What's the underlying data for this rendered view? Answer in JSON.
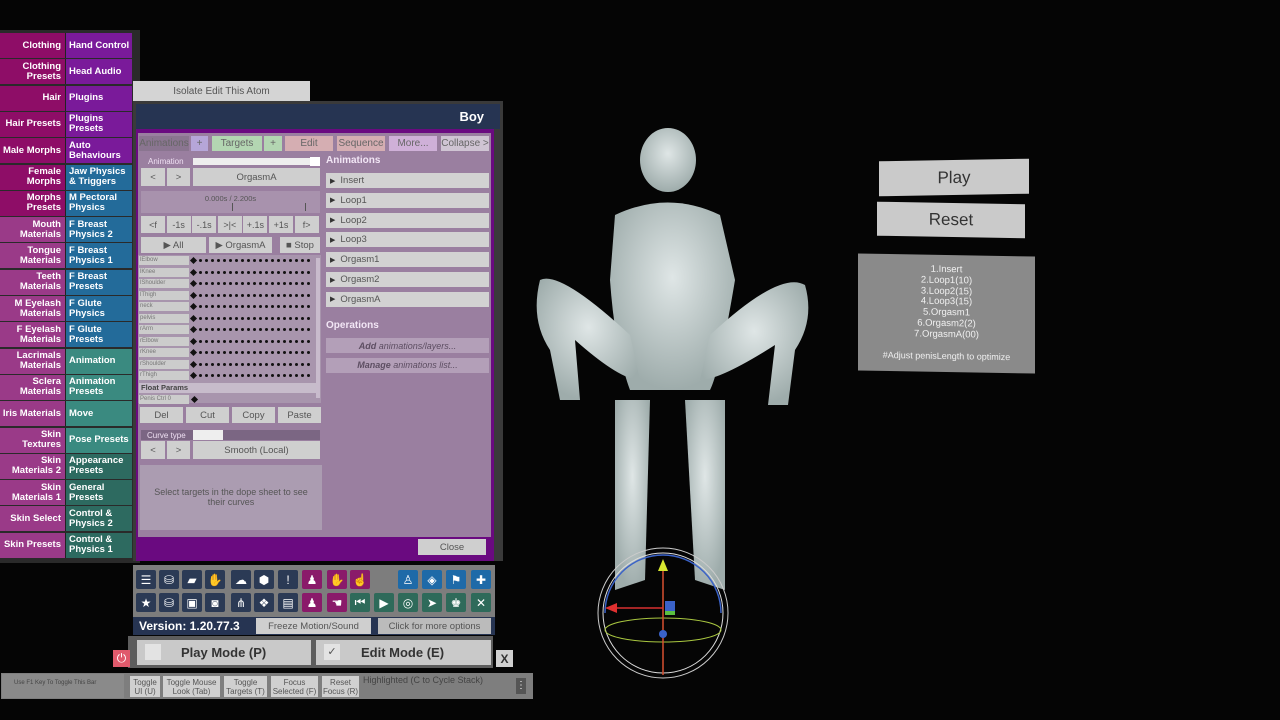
{
  "sidebar": {
    "rows": [
      {
        "left": "Clothing",
        "right": "Hand Control",
        "lc": "#8e0d67",
        "rc": "#7a1a9a"
      },
      {
        "left": "Clothing Presets",
        "right": "Head Audio",
        "lc": "#8e0d67",
        "rc": "#7a1a9a"
      },
      {
        "left": "Hair",
        "right": "Plugins",
        "lc": "#8e0d67",
        "rc": "#7a1a9a"
      },
      {
        "left": "Hair Presets",
        "right": "Plugins Presets",
        "lc": "#8e0d67",
        "rc": "#7a1a9a"
      },
      {
        "left": "Male Morphs",
        "right": "Auto Behaviours",
        "lc": "#8e0d67",
        "rc": "#7a1a9a"
      },
      {
        "left": "Female Morphs",
        "right": "Jaw Physics & Triggers",
        "lc": "#8e0d67",
        "rc": "#236b9a"
      },
      {
        "left": "Morphs Presets",
        "right": "M Pectoral Physics",
        "lc": "#8e0d67",
        "rc": "#236b9a"
      },
      {
        "left": "Mouth Materials",
        "right": "F Breast Physics 2",
        "lc": "#9a3a88",
        "rc": "#236b9a"
      },
      {
        "left": "Tongue Materials",
        "right": "F Breast Physics 1",
        "lc": "#9a3a88",
        "rc": "#236b9a"
      },
      {
        "left": "Teeth Materials",
        "right": "F Breast Presets",
        "lc": "#9a3a88",
        "rc": "#236b9a"
      },
      {
        "left": "M Eyelash Materials",
        "right": "F Glute Physics",
        "lc": "#9a3a88",
        "rc": "#236b9a"
      },
      {
        "left": "F Eyelash Materials",
        "right": "F Glute Presets",
        "lc": "#9a3a88",
        "rc": "#236b9a"
      },
      {
        "left": "Lacrimals Materials",
        "right": "Animation",
        "lc": "#9a3a88",
        "rc": "#3a8a80"
      },
      {
        "left": "Sclera Materials",
        "right": "Animation Presets",
        "lc": "#9a3a88",
        "rc": "#3a8a80"
      },
      {
        "left": "Iris Materials",
        "right": "Move",
        "lc": "#9a3a88",
        "rc": "#3a8a80"
      },
      {
        "left": "Skin Textures",
        "right": "Pose Presets",
        "lc": "#9a3a88",
        "rc": "#3a8a80"
      },
      {
        "left": "Skin Materials 2",
        "right": "Appearance Presets",
        "lc": "#9a3a88",
        "rc": "#2d6a60"
      },
      {
        "left": "Skin Materials 1",
        "right": "General Presets",
        "lc": "#9a3a88",
        "rc": "#2d6a60"
      },
      {
        "left": "Skin Select",
        "right": "Control & Physics 2",
        "lc": "#9a3a88",
        "rc": "#2d6a60"
      },
      {
        "left": "Skin Presets",
        "right": "Control & Physics 1",
        "lc": "#9a3a88",
        "rc": "#2d6a60"
      }
    ]
  },
  "isolate_button": "Isolate Edit This Atom",
  "atom_title": "Boy",
  "tabs": {
    "animations": "Animations",
    "add_anim": "+",
    "targets": "Targets",
    "add_target": "+",
    "edit": "Edit",
    "sequence": "Sequence",
    "more": "More...",
    "collapse": "Collapse >"
  },
  "animation_label": "Animation",
  "animation_slider_value": 1.0,
  "prev": "<",
  "next": ">",
  "current_animation": "OrgasmA",
  "time_readout": "0.000s / 2.200s",
  "transport": [
    "<f",
    "-1s",
    "-.1s",
    ">|<",
    "+.1s",
    "+1s",
    "f>"
  ],
  "play_all": "▶ All",
  "play_current": "▶ OrgasmA",
  "stop": "■ Stop",
  "dope_sheet": {
    "targets": [
      "lElbow",
      "lKnee",
      "lShoulder",
      "lThigh",
      "neck",
      "pelvis",
      "rArm",
      "rElbow",
      "rKnee",
      "rShoulder",
      "rThigh"
    ],
    "float_params_label": "Float Params",
    "float_params": [
      "Penis Ctrl 0"
    ]
  },
  "edit_buttons": [
    "Del",
    "Cut",
    "Copy",
    "Paste"
  ],
  "curve_type_label": "Curve type",
  "curve_type_value": "Smooth (Local)",
  "curve_hint": "Select targets in the dope sheet to see their curves",
  "animations_header": "Animations",
  "animations_list": [
    "Insert",
    "Loop1",
    "Loop2",
    "Loop3",
    "Orgasm1",
    "Orgasm2",
    "OrgasmA"
  ],
  "operations_header": "Operations",
  "operations": [
    {
      "bold": "Add",
      "rest": " animations/layers..."
    },
    {
      "bold": "Manage",
      "rest": " animations list..."
    }
  ],
  "close": "Close",
  "toolbar": {
    "row1": [
      {
        "name": "menu-icon",
        "glyph": "☰",
        "c": "nv"
      },
      {
        "name": "save-scene-icon",
        "glyph": "⛁",
        "c": "nv"
      },
      {
        "name": "open-folder-icon",
        "glyph": "▰",
        "c": "nv"
      },
      {
        "name": "red-hand-icon",
        "glyph": "✋",
        "c": "nv"
      },
      {
        "name": "cloud-download-icon",
        "glyph": "☁",
        "c": "nv"
      },
      {
        "name": "package-icon",
        "glyph": "⬢",
        "c": "nv"
      },
      {
        "name": "alert-icon",
        "glyph": "!",
        "c": "nv"
      },
      {
        "name": "add-person-icon",
        "glyph": "♟",
        "c": "mg"
      },
      {
        "name": "hand-icon",
        "glyph": "✋",
        "c": "mg"
      },
      {
        "name": "pointer-hand-icon",
        "glyph": "☝",
        "c": "mg"
      },
      {
        "name": "person-icon",
        "glyph": "♙",
        "c": "bl"
      },
      {
        "name": "unity-icon",
        "glyph": "◈",
        "c": "bl"
      },
      {
        "name": "flag-icon",
        "glyph": "⚑",
        "c": "bl"
      },
      {
        "name": "add-icon",
        "glyph": "✚",
        "c": "bl"
      }
    ],
    "row2": [
      {
        "name": "star-icon",
        "glyph": "★",
        "c": "nv"
      },
      {
        "name": "load-scene-icon",
        "glyph": "⛁",
        "c": "nv"
      },
      {
        "name": "folder-settings-icon",
        "glyph": "▣",
        "c": "nv"
      },
      {
        "name": "camera-icon",
        "glyph": "◙",
        "c": "nv"
      },
      {
        "name": "network-icon",
        "glyph": "⋔",
        "c": "nv"
      },
      {
        "name": "dropbox-icon",
        "glyph": "❖",
        "c": "nv"
      },
      {
        "name": "document-icon",
        "glyph": "▤",
        "c": "nv"
      },
      {
        "name": "remove-person-icon",
        "glyph": "♟",
        "c": "mg"
      },
      {
        "name": "grab-hand-icon",
        "glyph": "☚",
        "c": "mg"
      },
      {
        "name": "skip-back-icon",
        "glyph": "⏮",
        "c": "gr"
      },
      {
        "name": "play-icon",
        "glyph": "▶",
        "c": "gr"
      },
      {
        "name": "target-icon",
        "glyph": "◎",
        "c": "gr"
      },
      {
        "name": "cursor-icon",
        "glyph": "➤",
        "c": "gr"
      },
      {
        "name": "people-icon",
        "glyph": "♚",
        "c": "gr"
      },
      {
        "name": "tools-icon",
        "glyph": "✕",
        "c": "gr"
      }
    ]
  },
  "version": "Version: 1.20.77.3",
  "freeze_motion": "Freeze Motion/Sound",
  "more_options": "Click for more options",
  "play_mode": "Play Mode (P)",
  "edit_mode": "Edit Mode (E)",
  "edit_mode_checked": "✓",
  "close_x": "X",
  "f1_hint": "Use F1 Key To Toggle This Bar",
  "bottom_buttons": [
    "Toggle UI (U)",
    "Toggle Mouse Look (Tab)",
    "Toggle Targets (T)",
    "Focus Selected (F)",
    "Reset Focus (R)"
  ],
  "highlighted": "Highlighted (C to Cycle Stack)",
  "scene": {
    "play": "Play",
    "reset": "Reset",
    "info_lines": [
      "1.Insert",
      "2.Loop1(10)",
      "3.Loop2(15)",
      "4.Loop3(15)",
      "5.Orgasm1",
      "6.Orgasm2(2)",
      "7.OrgasmA(00)"
    ],
    "info_note": "#Adjust penisLength to optimize"
  }
}
